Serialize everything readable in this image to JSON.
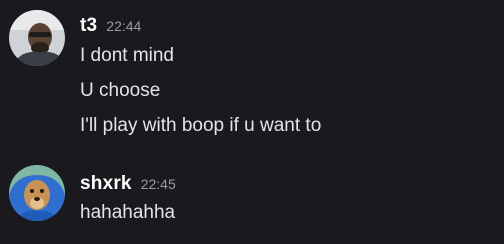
{
  "messages": [
    {
      "username": "t3",
      "timestamp": "22:44",
      "lines": [
        "I dont mind",
        "U choose",
        "I'll play with boop if u want to"
      ]
    },
    {
      "username": "shxrk",
      "timestamp": "22:45",
      "lines": [
        "hahahahha"
      ]
    }
  ],
  "colors": {
    "background": "#1a1a1e",
    "username": "#ffffff",
    "timestamp": "#9a9ba2",
    "message_text": "#e3e4e8"
  }
}
